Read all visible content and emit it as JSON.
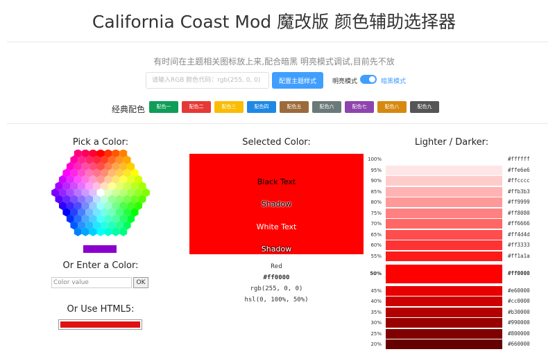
{
  "header": {
    "title": "California Coast Mod 魔改版 颜色辅助选择器",
    "subtitle": "有时间在主题相关图标放上来,配合暗黑 明亮模式调试,目前先不放"
  },
  "controls": {
    "rgb_placeholder": "请输入RGB 颜色代码：rgb(255, 0, 0)",
    "config_button": "配置主题样式",
    "light_mode": "明亮模式",
    "dark_mode": "暗黑模式",
    "dark_mode_on": true
  },
  "classic": {
    "label": "经典配色",
    "chips": [
      {
        "label": "配色一",
        "color": "#0f9d58"
      },
      {
        "label": "配色二",
        "color": "#e53935"
      },
      {
        "label": "配色三",
        "color": "#fbbc05"
      },
      {
        "label": "配色四",
        "color": "#1e88e5"
      },
      {
        "label": "配色五",
        "color": "#9c6b3c"
      },
      {
        "label": "配色六",
        "color": "#6b7a78"
      },
      {
        "label": "配色七",
        "color": "#8e44ad"
      },
      {
        "label": "配色八",
        "color": "#d68910"
      },
      {
        "label": "配色九",
        "color": "#555555"
      }
    ]
  },
  "picker": {
    "title": "Pick a Color:",
    "enter_title": "Or Enter a Color:",
    "input_placeholder": "Color value",
    "ok_label": "OK",
    "html5_title": "Or Use HTML5:",
    "chosen_color": "#8a00cc",
    "html5_color": "#e11111"
  },
  "selected": {
    "title": "Selected Color:",
    "color": "#ff0000",
    "texts": [
      "Black Text",
      "Shadow",
      "White Text",
      "Shadow"
    ],
    "name": "Red",
    "hex": "#ff0000",
    "rgb": "rgb(255, 0, 0)",
    "hsl": "hsl(0, 100%, 50%)"
  },
  "shades": {
    "title": "Lighter / Darker:",
    "rows": [
      {
        "pct": "100%",
        "hex": "#ffffff"
      },
      {
        "pct": "95%",
        "hex": "#ffe6e6"
      },
      {
        "pct": "90%",
        "hex": "#ffcccc"
      },
      {
        "pct": "85%",
        "hex": "#ffb3b3"
      },
      {
        "pct": "80%",
        "hex": "#ff9999"
      },
      {
        "pct": "75%",
        "hex": "#ff8080"
      },
      {
        "pct": "70%",
        "hex": "#ff6666"
      },
      {
        "pct": "65%",
        "hex": "#ff4d4d"
      },
      {
        "pct": "60%",
        "hex": "#ff3333"
      },
      {
        "pct": "55%",
        "hex": "#ff1a1a"
      },
      {
        "pct": "50%",
        "hex": "#ff0000",
        "base": true
      },
      {
        "pct": "45%",
        "hex": "#e60000"
      },
      {
        "pct": "40%",
        "hex": "#cc0000"
      },
      {
        "pct": "35%",
        "hex": "#b30000"
      },
      {
        "pct": "30%",
        "hex": "#990000"
      },
      {
        "pct": "25%",
        "hex": "#800000"
      },
      {
        "pct": "20%",
        "hex": "#660000"
      }
    ]
  }
}
